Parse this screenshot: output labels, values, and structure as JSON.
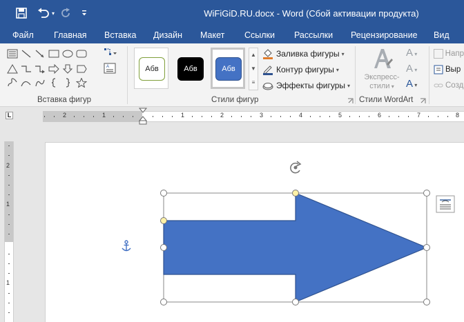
{
  "titlebar": {
    "title": "WiFiGiD.RU.docx - Word (Сбой активации продукта)",
    "icons": [
      "save-icon",
      "undo-icon",
      "redo-icon",
      "customize-quick-access-icon"
    ]
  },
  "tabs": [
    "Файл",
    "Главная",
    "Вставка",
    "Дизайн",
    "Макет",
    "Ссылки",
    "Рассылки",
    "Рецензирование",
    "Вид"
  ],
  "ribbon": {
    "insert_shapes": {
      "label": "Вставка фигур",
      "shapes": [
        "line",
        "arrow-line",
        "rectangle",
        "oval",
        "rounded-rectangle",
        "triangle",
        "elbow-connector",
        "right-arrow",
        "down-arrow",
        "pentagon",
        "freeform",
        "curve",
        "arc",
        "left-brace",
        "right-brace",
        "star"
      ]
    },
    "shape_styles": {
      "label": "Стили фигур",
      "styles": [
        {
          "text": "Абв",
          "fill": "#ffffff",
          "border": "#7f9f3a",
          "color": "#222222"
        },
        {
          "text": "Абв",
          "fill": "#000000",
          "border": "#000000",
          "color": "#ffffff"
        },
        {
          "text": "Абв",
          "fill": "#4472c4",
          "border": "#2f528f",
          "color": "#ffffff"
        }
      ],
      "fill": "Заливка фигуры",
      "outline": "Контур фигуры",
      "effects": "Эффекты фигуры"
    },
    "wordart": {
      "label": "Стили WordArt",
      "express_line1": "Экспресс-",
      "express_line2": "стили"
    },
    "arrange": {
      "item1": "Напр",
      "item2": "Выр",
      "item3": "Созд"
    }
  },
  "ruler": {
    "h_numbers": [
      "2",
      "1",
      "1",
      "2",
      "3",
      "4",
      "5",
      "6",
      "7",
      "8"
    ],
    "v_numbers": [
      "2",
      "1",
      "1"
    ]
  },
  "colors": {
    "accent": "#2b579a",
    "shape_fill": "#4472c4",
    "shape_outline": "#2f528f",
    "handle_yellow": "#fff2a8"
  }
}
